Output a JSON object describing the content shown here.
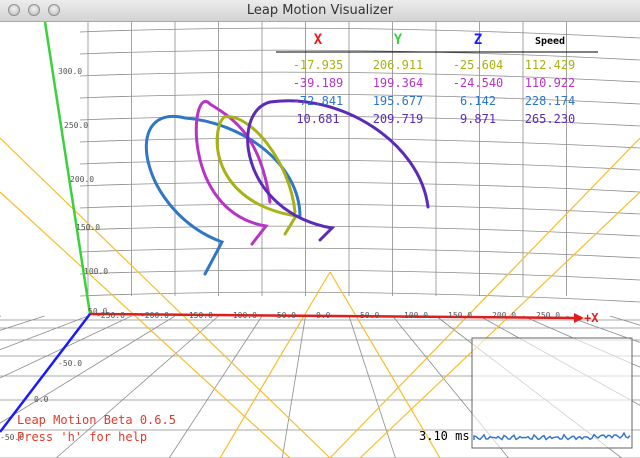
{
  "window": {
    "title": "Leap Motion Visualizer"
  },
  "table": {
    "headers": [
      {
        "label": "X",
        "color": "#e21b1b"
      },
      {
        "label": "Y",
        "color": "#3ad23a"
      },
      {
        "label": "Z",
        "color": "#1a1aff"
      },
      {
        "label": "Speed",
        "color": "#000000"
      }
    ],
    "rows": [
      {
        "color": "#a7b214",
        "values": [
          "-17.935",
          "206.911",
          "-25.604",
          "112.429"
        ]
      },
      {
        "color": "#b834c4",
        "values": [
          "-39.189",
          "199.364",
          "-24.540",
          "110.922"
        ]
      },
      {
        "color": "#2f76c6",
        "values": [
          "-72.841",
          "195.677",
          "6.142",
          "228.174"
        ]
      },
      {
        "color": "#5b2bb8",
        "values": [
          "10.681",
          "209.719",
          "9.871",
          "265.230"
        ]
      }
    ]
  },
  "y_ticks": [
    "300.0",
    "250.0",
    "200.0",
    "150.0",
    "100.0",
    "50.0"
  ],
  "x_ticks": [
    "-250.0",
    "-200.0",
    "-150.0",
    "-100.0",
    "-50.0",
    "0.0",
    "50.0",
    "100.0",
    "150.0",
    "200.0",
    "250.0"
  ],
  "z_ticks": [
    "-50.0",
    "0.0",
    "-50.0"
  ],
  "x_axis_label": "+X",
  "footer": {
    "version": "Leap Motion Beta 0.6.5",
    "help": "Press 'h' for help",
    "color": "#e23a2a"
  },
  "perf": {
    "label": "3.10 ms"
  },
  "colors": {
    "x_axis": "#e21b1b",
    "y_axis": "#3ad23a",
    "z_axis": "#1a1aff",
    "guides": "#f5bf2a",
    "grid": "#8c8c8c"
  }
}
